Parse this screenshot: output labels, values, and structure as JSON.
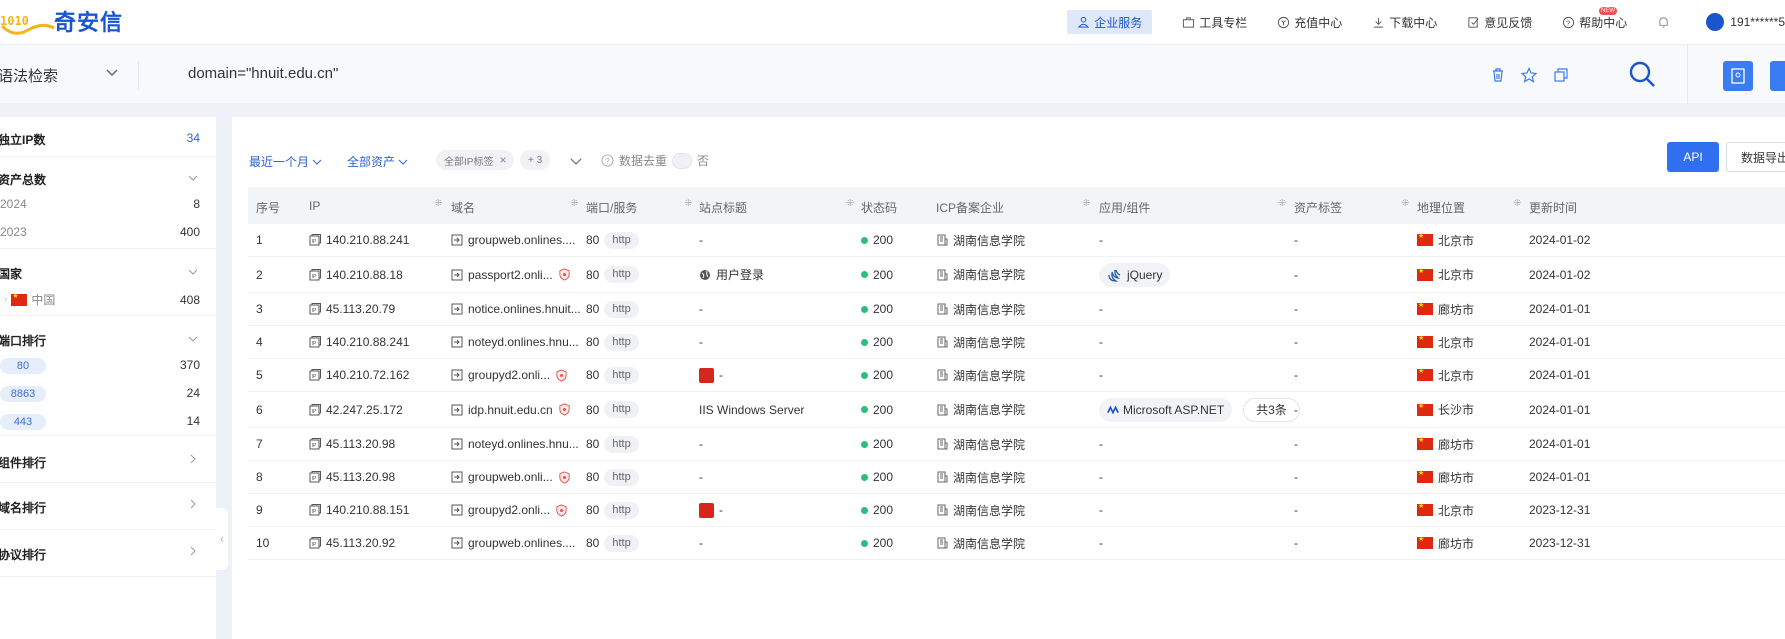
{
  "header": {
    "logo_digits": "1010",
    "logo_text": "奇安信",
    "nav": [
      {
        "label": "企业服务",
        "icon": "enterprise-icon"
      },
      {
        "label": "工具专栏",
        "icon": "toolbox-icon"
      },
      {
        "label": "充值中心",
        "icon": "recharge-icon"
      },
      {
        "label": "下载中心",
        "icon": "download-icon"
      },
      {
        "label": "意见反馈",
        "icon": "feedback-icon",
        "badge": "NEW"
      },
      {
        "label": "帮助中心",
        "icon": "help-icon"
      }
    ],
    "user": "191******5"
  },
  "search": {
    "mode": "语法检索",
    "query": "domain=\"hnuit.edu.cn\""
  },
  "sidebar": {
    "unique_ip": {
      "label": "独立IP数",
      "value": "34"
    },
    "asset_total": {
      "label": "资产总数",
      "items": [
        {
          "label": "2024",
          "count": "8"
        },
        {
          "label": "2023",
          "count": "400"
        }
      ]
    },
    "country": {
      "label": "国家",
      "items": [
        {
          "label": "中国",
          "count": "408"
        }
      ]
    },
    "port_rank": {
      "label": "端口排行",
      "items": [
        {
          "label": "80",
          "count": "370"
        },
        {
          "label": "8863",
          "count": "24"
        },
        {
          "label": "443",
          "count": "14"
        }
      ]
    },
    "component_rank": {
      "label": "组件排行"
    },
    "domain_rank": {
      "label": "域名排行"
    },
    "protocol_rank": {
      "label": "协议排行"
    }
  },
  "filters": {
    "time": "最近一个月",
    "asset": "全部资产",
    "ip_tag": "全部IP标签",
    "tag_more": "+ 3",
    "dedupe_label": "数据去重",
    "dedupe_value": "否",
    "api": "API",
    "export": "数据导出"
  },
  "table": {
    "headers": [
      "序号",
      "IP",
      "域名",
      "端口/服务",
      "站点标题",
      "状态码",
      "ICP备案企业",
      "应用/组件",
      "资产标签",
      "地理位置",
      "更新时间"
    ],
    "rows": [
      {
        "no": "1",
        "ip": "140.210.88.241",
        "domain": "groupweb.onlines....",
        "shield": false,
        "port": "80",
        "svc": "http",
        "title": "-",
        "title_icon": "",
        "status": "200",
        "icp": "湖南信息学院",
        "comp": "-",
        "comp_icon": "",
        "comp_more": "",
        "tag": "-",
        "geo": "北京市",
        "time": "2024-01-02"
      },
      {
        "no": "2",
        "ip": "140.210.88.18",
        "domain": "passport2.onli...",
        "shield": true,
        "port": "80",
        "svc": "http",
        "title": "用户登录",
        "title_icon": "globe",
        "status": "200",
        "icp": "湖南信息学院",
        "comp": "jQuery",
        "comp_icon": "jquery",
        "comp_more": "",
        "tag": "-",
        "geo": "北京市",
        "time": "2024-01-02"
      },
      {
        "no": "3",
        "ip": "45.113.20.79",
        "domain": "notice.onlines.hnuit...",
        "shield": false,
        "port": "80",
        "svc": "http",
        "title": "-",
        "title_icon": "",
        "status": "200",
        "icp": "湖南信息学院",
        "comp": "-",
        "comp_icon": "",
        "comp_more": "",
        "tag": "-",
        "geo": "廊坊市",
        "time": "2024-01-01"
      },
      {
        "no": "4",
        "ip": "140.210.88.241",
        "domain": "noteyd.onlines.hnu...",
        "shield": false,
        "port": "80",
        "svc": "http",
        "title": "-",
        "title_icon": "",
        "status": "200",
        "icp": "湖南信息学院",
        "comp": "-",
        "comp_icon": "",
        "comp_more": "",
        "tag": "-",
        "geo": "北京市",
        "time": "2024-01-01"
      },
      {
        "no": "5",
        "ip": "140.210.72.162",
        "domain": "groupyd2.onli...",
        "shield": true,
        "port": "80",
        "svc": "http",
        "title": "-",
        "title_icon": "red",
        "status": "200",
        "icp": "湖南信息学院",
        "comp": "-",
        "comp_icon": "",
        "comp_more": "",
        "tag": "-",
        "geo": "北京市",
        "time": "2024-01-01"
      },
      {
        "no": "6",
        "ip": "42.247.25.172",
        "domain": "idp.hnuit.edu.cn",
        "shield": true,
        "port": "80",
        "svc": "http",
        "title": "IIS Windows Server",
        "title_icon": "",
        "status": "200",
        "icp": "湖南信息学院",
        "comp": "Microsoft ASP.NET",
        "comp_icon": "aspnet",
        "comp_more": "共3条",
        "tag": "-",
        "geo": "长沙市",
        "time": "2024-01-01"
      },
      {
        "no": "7",
        "ip": "45.113.20.98",
        "domain": "noteyd.onlines.hnu...",
        "shield": false,
        "port": "80",
        "svc": "http",
        "title": "-",
        "title_icon": "",
        "status": "200",
        "icp": "湖南信息学院",
        "comp": "-",
        "comp_icon": "",
        "comp_more": "",
        "tag": "-",
        "geo": "廊坊市",
        "time": "2024-01-01"
      },
      {
        "no": "8",
        "ip": "45.113.20.98",
        "domain": "groupweb.onli...",
        "shield": true,
        "port": "80",
        "svc": "http",
        "title": "-",
        "title_icon": "",
        "status": "200",
        "icp": "湖南信息学院",
        "comp": "-",
        "comp_icon": "",
        "comp_more": "",
        "tag": "-",
        "geo": "廊坊市",
        "time": "2024-01-01"
      },
      {
        "no": "9",
        "ip": "140.210.88.151",
        "domain": "groupyd2.onli...",
        "shield": true,
        "port": "80",
        "svc": "http",
        "title": "-",
        "title_icon": "red",
        "status": "200",
        "icp": "湖南信息学院",
        "comp": "-",
        "comp_icon": "",
        "comp_more": "",
        "tag": "-",
        "geo": "北京市",
        "time": "2023-12-31"
      },
      {
        "no": "10",
        "ip": "45.113.20.92",
        "domain": "groupweb.onlines....",
        "shield": false,
        "port": "80",
        "svc": "http",
        "title": "-",
        "title_icon": "",
        "status": "200",
        "icp": "湖南信息学院",
        "comp": "-",
        "comp_icon": "",
        "comp_more": "",
        "tag": "-",
        "geo": "廊坊市",
        "time": "2023-12-31"
      }
    ]
  }
}
